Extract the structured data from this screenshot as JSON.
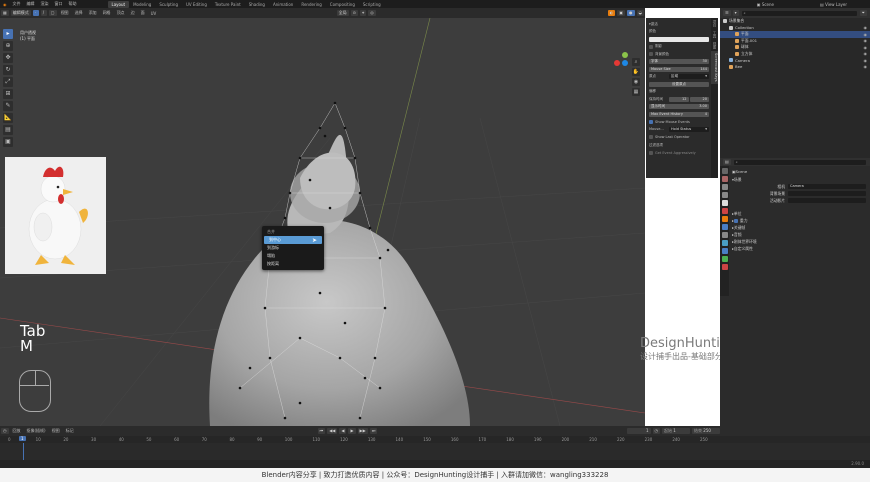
{
  "topbar": {
    "menus": [
      "文件",
      "编辑",
      "渲染",
      "窗口",
      "帮助"
    ],
    "workspace_tabs": [
      "Layout",
      "Modeling",
      "Sculpting",
      "UV Editing",
      "Texture Paint",
      "Shading",
      "Animation",
      "Rendering",
      "Compositing",
      "Scripting"
    ],
    "active_tab": "Layout",
    "scene_label": "Scene",
    "view_layer_label": "View Layer"
  },
  "viewport_header": {
    "mode": "编辑模式",
    "menu": [
      "视图",
      "选择",
      "添加",
      "网格",
      "顶点",
      "边",
      "面",
      "UV"
    ],
    "transform_orientation": "全局",
    "overlay_info": [
      "用户透视",
      "(1) 平面"
    ]
  },
  "context_menu": {
    "title": "合并",
    "items": [
      "到中心",
      "到游标",
      "塌陷",
      "按距离"
    ],
    "highlighted": "到中心"
  },
  "keys_overlay": {
    "line1": "Tab",
    "line2": "M"
  },
  "watermark": {
    "title": "DesignHunting",
    "subtitle": "设计捕手出品-基础部分"
  },
  "npanel": {
    "tabs": [
      "项目",
      "工具",
      "视图",
      "Screencast Keys"
    ],
    "active_tab": "Screencast Keys",
    "section_title": "激活",
    "rows": [
      {
        "label": "颜色",
        "value": ""
      },
      {
        "label": "阴影",
        "value": ""
      },
      {
        "label": "背景颜色",
        "value": ""
      },
      {
        "label": "字体",
        "value": "30"
      },
      {
        "label": "Mouse Size",
        "value": "144"
      },
      {
        "label": "原点",
        "value": "区域"
      },
      {
        "label": "设置原点",
        "value": ""
      },
      {
        "label": "偏移",
        "value": ""
      },
      {
        "label": "保持时间",
        "value": "12",
        "value2": "20"
      },
      {
        "label": "显示时间",
        "value": "3.00"
      },
      {
        "label": "Max Event History",
        "value": "4"
      },
      {
        "label": "Show Mouse Events",
        "value": ""
      },
      {
        "label": "Mouse...",
        "value": "Hold Status"
      },
      {
        "label": "Show Last Operator",
        "value": ""
      },
      {
        "label": "Get Event Aggressively",
        "value": ""
      }
    ],
    "options_label": "过滤选项"
  },
  "outliner": {
    "search_placeholder": "",
    "items": [
      {
        "label": "场景集合",
        "indent": 0,
        "color": "#cccccc"
      },
      {
        "label": "Collection",
        "indent": 1,
        "color": "#cccccc"
      },
      {
        "label": "平面",
        "indent": 2,
        "color": "#e0a35a",
        "selected": true
      },
      {
        "label": "平面.001",
        "indent": 2,
        "color": "#e0a35a"
      },
      {
        "label": "球体",
        "indent": 2,
        "color": "#e0a35a"
      },
      {
        "label": "立方体",
        "indent": 2,
        "color": "#e0a35a"
      },
      {
        "label": "Camera",
        "indent": 1,
        "color": "#88b3e0"
      },
      {
        "label": "Bee",
        "indent": 1,
        "color": "#e0a35a"
      }
    ]
  },
  "properties": {
    "title": "Scene",
    "section": "场景",
    "rows": [
      {
        "label": "相机",
        "value": "Camera"
      },
      {
        "label": "背景场景",
        "value": ""
      },
      {
        "label": "活动影片",
        "value": ""
      }
    ],
    "panels": [
      "单位",
      "重力",
      "关键帧",
      "音频",
      "刚体世界环境",
      "自定义属性"
    ]
  },
  "timeline": {
    "menu": [
      "回放",
      "抠像(插帧)",
      "视图",
      "标记"
    ],
    "current_frame": "1",
    "start": "1",
    "end": "250",
    "ruler_ticks": [
      "0",
      "10",
      "20",
      "30",
      "40",
      "50",
      "60",
      "70",
      "80",
      "90",
      "100",
      "110",
      "120",
      "130",
      "140",
      "150",
      "160",
      "170",
      "180",
      "190",
      "200",
      "210",
      "220",
      "230",
      "240",
      "250"
    ],
    "version": "2.90.0"
  },
  "caption": {
    "text": "Blender内容分享  |  致力打造优质内容  |  公众号：DesignHunting设计捕手  |  入群请加微信：wangling333228"
  }
}
